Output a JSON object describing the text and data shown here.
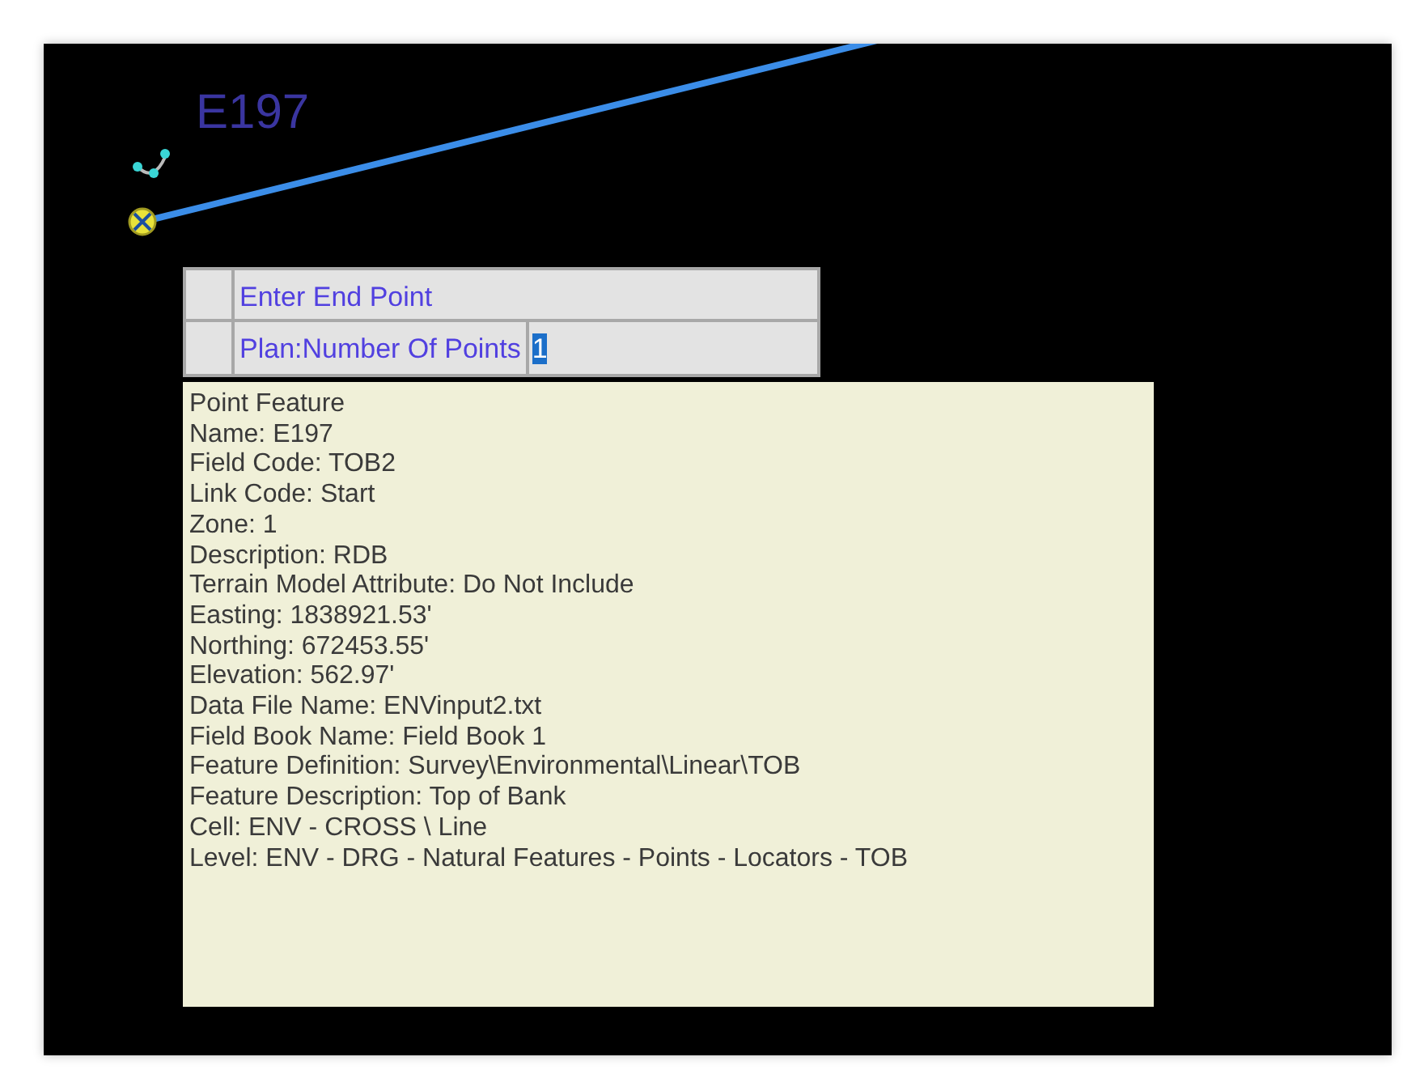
{
  "canvas": {
    "point_label": "E197"
  },
  "prompt": {
    "rows": [
      {
        "label": "Enter End Point"
      },
      {
        "label": "Plan:Number Of Points",
        "value": "1",
        "selected": true
      }
    ]
  },
  "tooltip": {
    "lines": [
      "Point Feature",
      "Name: E197",
      "Field Code: TOB2",
      "Link Code: Start",
      "Zone: 1",
      "Description:  RDB",
      "Terrain Model Attribute: Do Not Include",
      "Easting:  1838921.53'",
      "Northing:  672453.55'",
      "Elevation:  562.97'",
      "Data File Name: ENVinput2.txt",
      "Field Book Name: Field Book 1",
      "Feature Definition:  Survey\\Environmental\\Linear\\TOB",
      "Feature Description: Top of Bank",
      "Cell: ENV - CROSS \\ Line",
      "Level: ENV - DRG - Natural Features - Points - Locators - TOB"
    ]
  }
}
